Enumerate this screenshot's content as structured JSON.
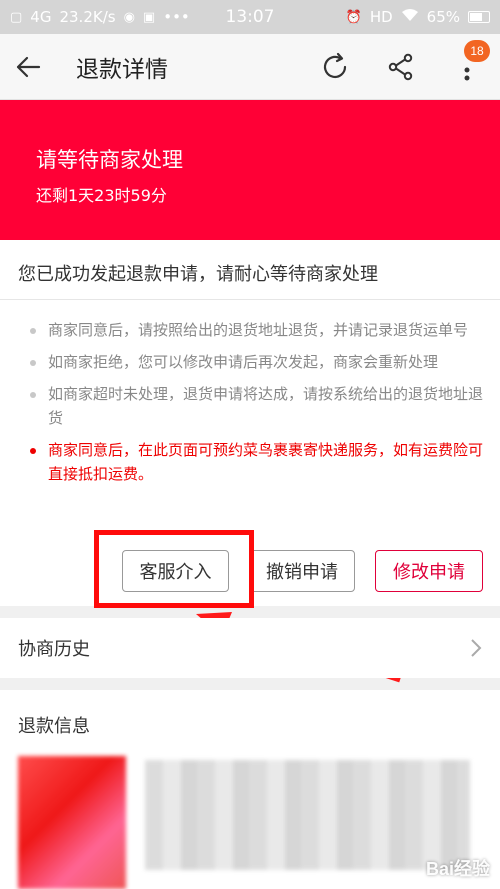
{
  "status_bar": {
    "network": "4G",
    "speed": "23.2K/s",
    "time": "13:07",
    "hd": "HD",
    "battery": "65%"
  },
  "nav": {
    "title": "退款详情",
    "badge_count": "18",
    "icons": [
      "back-arrow-icon",
      "refresh-icon",
      "share-icon",
      "more-icon"
    ]
  },
  "hero": {
    "title": "请等待商家处理",
    "subtitle": "还剩1天23时59分",
    "color": "#ff0036"
  },
  "card": {
    "heading": "您已成功发起退款申请，请耐心等待商家处理",
    "tips": [
      "商家同意后，请按照给出的退货地址退货，并请记录退货运单号",
      "如商家拒绝，您可以修改申请后再次发起，商家会重新处理",
      "如商家超时未处理，退货申请将达成，请按系统给出的退货地址退货",
      "商家同意后，在此页面可预约菜鸟裹裹寄快递服务，如有运费险可直接抵扣运费。"
    ],
    "buttons": {
      "service": "客服介入",
      "cancel": "撤销申请",
      "modify": "修改申请"
    }
  },
  "history": {
    "label": "协商历史"
  },
  "refund_info": {
    "title": "退款信息"
  },
  "watermark": "Bai经验"
}
